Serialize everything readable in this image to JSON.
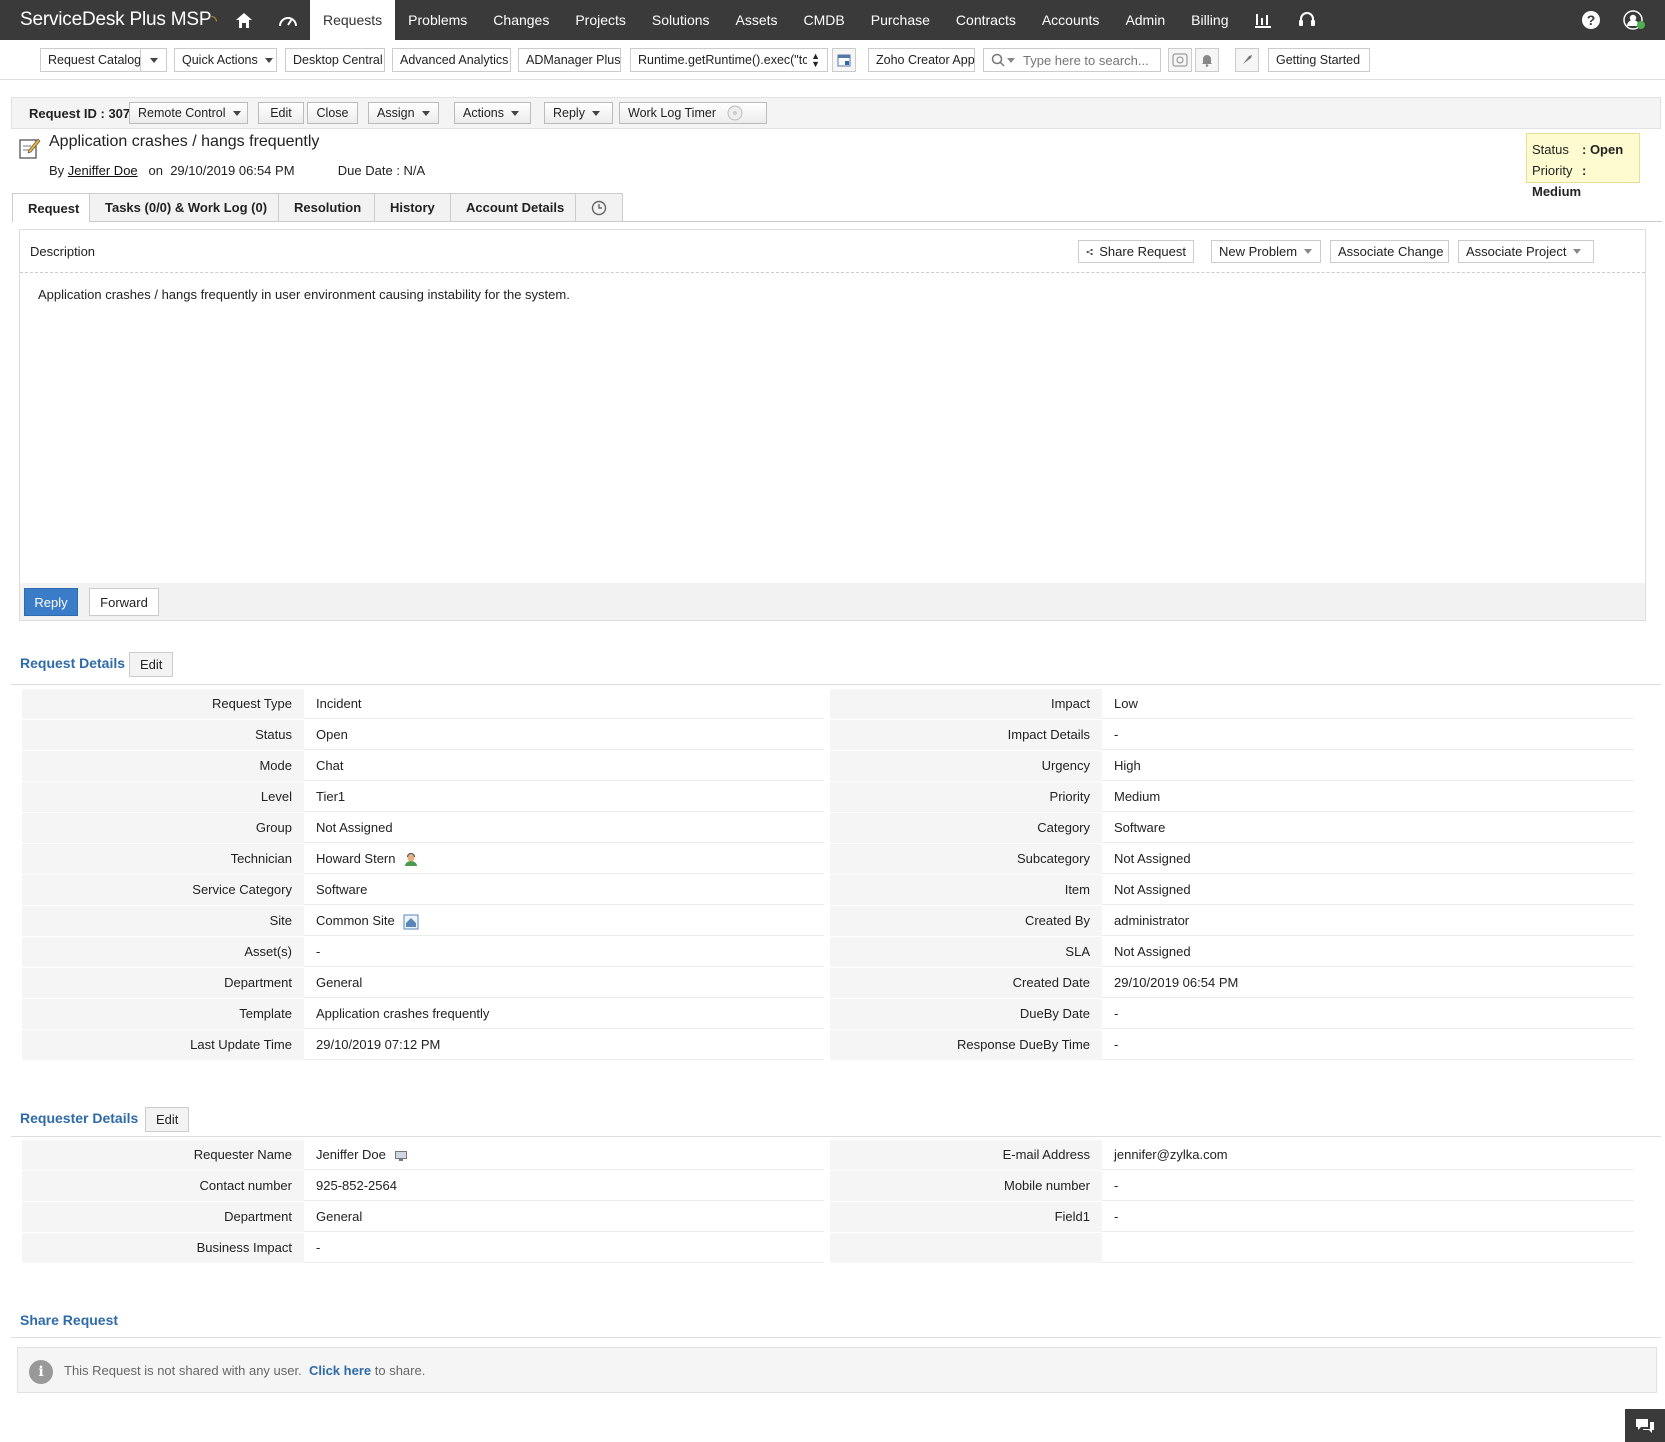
{
  "app": {
    "title": "ServiceDesk Plus MSP"
  },
  "nav": {
    "tabs": [
      {
        "label": "Requests",
        "active": true
      },
      {
        "label": "Problems"
      },
      {
        "label": "Changes"
      },
      {
        "label": "Projects"
      },
      {
        "label": "Solutions"
      },
      {
        "label": "Assets"
      },
      {
        "label": "CMDB"
      },
      {
        "label": "Purchase"
      },
      {
        "label": "Contracts"
      },
      {
        "label": "Accounts"
      },
      {
        "label": "Admin"
      },
      {
        "label": "Billing"
      }
    ],
    "icons": [
      "home-icon",
      "dashboard-icon",
      "reports-icon",
      "support-headset-icon",
      "help-icon",
      "user-profile-icon"
    ]
  },
  "toolbar": {
    "request_catalog": "Request Catalog",
    "quick_actions": "Quick Actions",
    "desktop_central": "Desktop Central",
    "advanced_analytics": "Advanced Analytics",
    "admanager_plus": "ADManager Plus",
    "runtime_select": "Runtime.getRuntime().exec(\"tc",
    "zoho_creator": "Zoho Creator App",
    "search_placeholder": "Type here to search...",
    "getting_started": "Getting Started"
  },
  "request": {
    "id_label": "Request ID : 307",
    "remote_control": "Remote Control",
    "edit": "Edit",
    "close": "Close",
    "assign": "Assign",
    "actions": "Actions",
    "reply": "Reply",
    "work_log_timer": "Work Log Timer",
    "title": "Application crashes / hangs frequently",
    "by": "By",
    "requester": "Jeniffer Doe",
    "on": "on",
    "created": "29/10/2019 06:54 PM",
    "due_date": "Due Date : N/A",
    "status_label": "Status",
    "status_value": ": Open",
    "priority_label": "Priority",
    "priority_value": ": Medium"
  },
  "tabs": [
    {
      "label": "Request",
      "active": true
    },
    {
      "label": "Tasks (0/0) & Work Log (0)"
    },
    {
      "label": "Resolution"
    },
    {
      "label": "History"
    },
    {
      "label": "Account Details"
    }
  ],
  "description": {
    "label": "Description",
    "share_request": "Share Request",
    "new_problem": "New Problem",
    "associate_change": "Associate Change",
    "associate_project": "Associate Project",
    "text": "Application crashes / hangs frequently in user environment causing instability for the system.",
    "reply": "Reply",
    "forward": "Forward"
  },
  "request_details": {
    "title": "Request Details",
    "edit": "Edit",
    "rows": [
      {
        "l": "Request Type",
        "lv": "Incident",
        "r": "Impact",
        "rv": "Low"
      },
      {
        "l": "Status",
        "lv": "Open",
        "r": "Impact Details",
        "rv": "-"
      },
      {
        "l": "Mode",
        "lv": "Chat",
        "r": "Urgency",
        "rv": "High"
      },
      {
        "l": "Level",
        "lv": "Tier1",
        "r": "Priority",
        "rv": "Medium"
      },
      {
        "l": "Group",
        "lv": "Not Assigned",
        "r": "Category",
        "rv": "Software"
      },
      {
        "l": "Technician",
        "lv": "Howard Stern",
        "r": "Subcategory",
        "rv": "Not Assigned"
      },
      {
        "l": "Service Category",
        "lv": "Software",
        "r": "Item",
        "rv": "Not Assigned"
      },
      {
        "l": "Site",
        "lv": "Common Site",
        "r": "Created By",
        "rv": "administrator"
      },
      {
        "l": "Asset(s)",
        "lv": "-",
        "r": "SLA",
        "rv": "Not Assigned"
      },
      {
        "l": "Department",
        "lv": "General",
        "r": "Created Date",
        "rv": "29/10/2019 06:54 PM"
      },
      {
        "l": "Template",
        "lv": "Application crashes frequently",
        "r": "DueBy Date",
        "rv": "-"
      },
      {
        "l": "Last Update Time",
        "lv": "29/10/2019 07:12 PM",
        "r": "Response DueBy Time",
        "rv": "-"
      }
    ]
  },
  "requester_details": {
    "title": "Requester Details",
    "edit": "Edit",
    "rows": [
      {
        "l": "Requester Name",
        "lv": "Jeniffer Doe",
        "r": "E-mail Address",
        "rv": "jennifer@zylka.com"
      },
      {
        "l": "Contact number",
        "lv": "925-852-2564",
        "r": "Mobile number",
        "rv": "-"
      },
      {
        "l": "Department",
        "lv": "General",
        "r": "Field1",
        "rv": "-"
      },
      {
        "l": "Business Impact",
        "lv": "-",
        "r": "",
        "rv": ""
      }
    ]
  },
  "share": {
    "title": "Share Request",
    "text": "This Request is not shared with any user.",
    "link": "Click here",
    "suffix": " to share."
  },
  "colors": {
    "nav_bg": "#3a3a3a",
    "accent": "#2f6ba8",
    "reply_btn": "#3a7cc8",
    "status_box": "#fffbd0"
  }
}
